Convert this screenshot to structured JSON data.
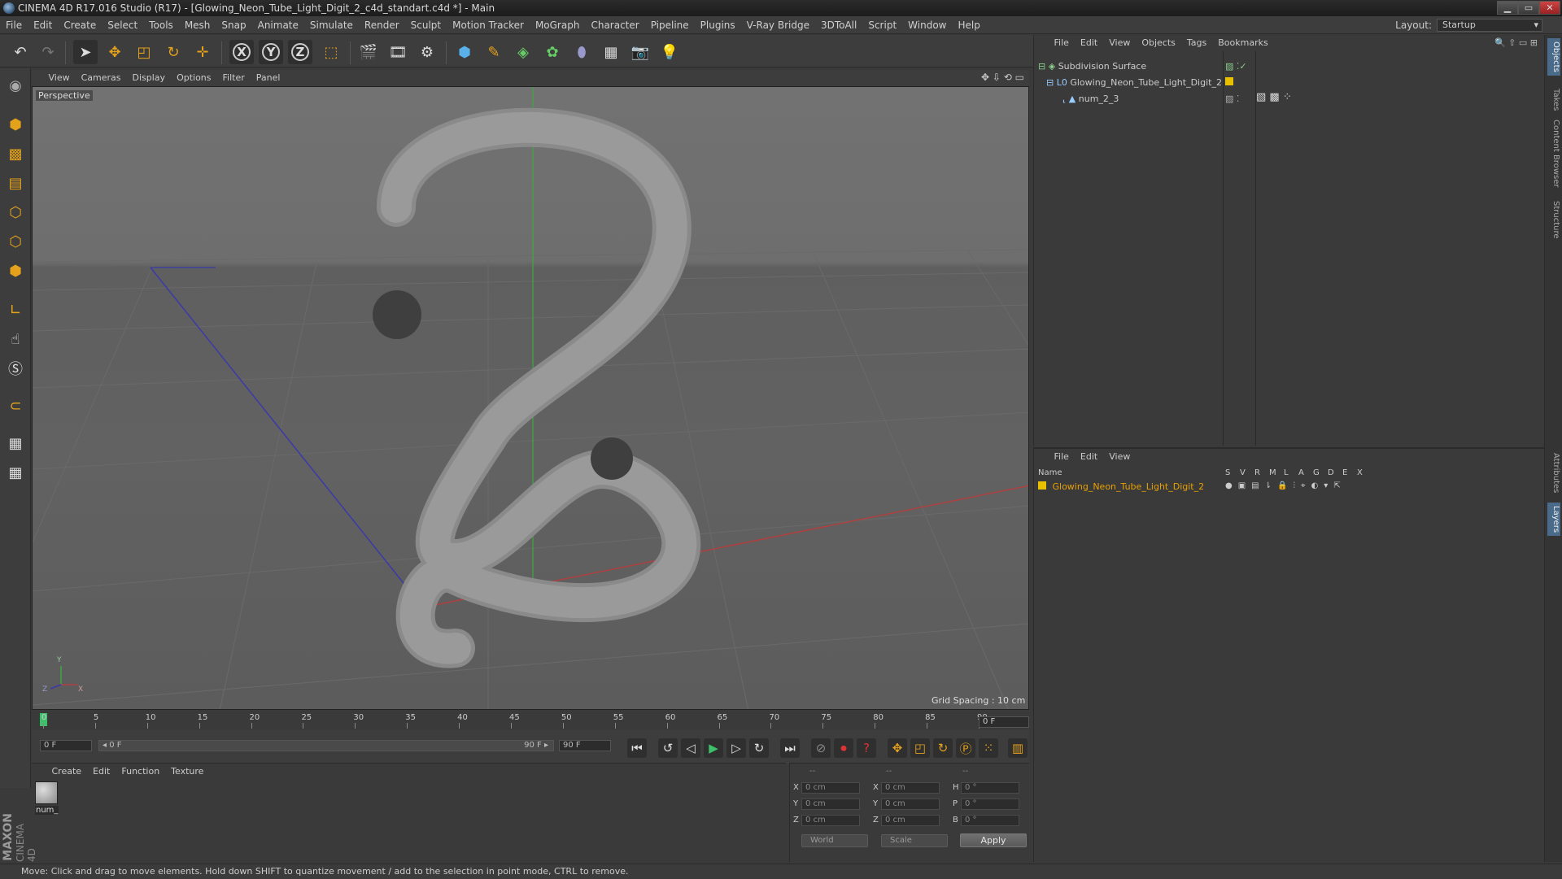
{
  "window": {
    "title": "CINEMA 4D R17.016 Studio (R17) - [Glowing_Neon_Tube_Light_Digit_2_c4d_standart.c4d *] - Main",
    "buttons": [
      "▁",
      "▭",
      "✕"
    ]
  },
  "menu": {
    "items": [
      "File",
      "Edit",
      "Create",
      "Select",
      "Tools",
      "Mesh",
      "Snap",
      "Animate",
      "Simulate",
      "Render",
      "Sculpt",
      "Motion Tracker",
      "MoGraph",
      "Character",
      "Pipeline",
      "Plugins",
      "V-Ray Bridge",
      "3DToAll",
      "Script",
      "Window",
      "Help"
    ],
    "layout_label": "Layout:",
    "layout_value": "Startup"
  },
  "toolbar": {
    "x_label": "X",
    "y_label": "Y",
    "z_label": "Z"
  },
  "viewport": {
    "menu": [
      "View",
      "Cameras",
      "Display",
      "Options",
      "Filter",
      "Panel"
    ],
    "label": "Perspective",
    "grid_spacing": "Grid Spacing : 10 cm",
    "axis_y": "Y",
    "axis_z": "Z",
    "axis_x": "X"
  },
  "timeline": {
    "ticks": [
      "0",
      "5",
      "10",
      "15",
      "20",
      "25",
      "30",
      "35",
      "40",
      "45",
      "50",
      "55",
      "60",
      "65",
      "70",
      "75",
      "80",
      "85",
      "90"
    ],
    "current_frame": "0 F"
  },
  "transport": {
    "start_field": "0 F",
    "range_start": "◂ 0 F",
    "range_end": "90 F ▸",
    "end_field": "90 F"
  },
  "materials": {
    "menu": [
      "Create",
      "Edit",
      "Function",
      "Texture"
    ],
    "items": [
      {
        "name": "num_"
      }
    ]
  },
  "coordinates": {
    "header": [
      "--",
      "--",
      "--"
    ],
    "rows": [
      {
        "axis": "X",
        "pos": "0 cm",
        "axis2": "X",
        "size": "0 cm",
        "rot_label": "H",
        "rot": "0 °"
      },
      {
        "axis": "Y",
        "pos": "0 cm",
        "axis2": "Y",
        "size": "0 cm",
        "rot_label": "P",
        "rot": "0 °"
      },
      {
        "axis": "Z",
        "pos": "0 cm",
        "axis2": "Z",
        "size": "0 cm",
        "rot_label": "B",
        "rot": "0 °"
      }
    ],
    "world": "World",
    "scale": "Scale",
    "apply": "Apply"
  },
  "status": {
    "text": "Move: Click and drag to move elements. Hold down SHIFT to quantize movement / add to the selection in point mode, CTRL to remove."
  },
  "objects": {
    "menu": [
      "File",
      "Edit",
      "View",
      "Objects",
      "Tags",
      "Bookmarks"
    ],
    "tree": [
      {
        "name": "Subdivision Surface",
        "indent": 0
      },
      {
        "name": "Glowing_Neon_Tube_Light_Digit_2",
        "indent": 1
      },
      {
        "name": "num_2_3",
        "indent": 2
      }
    ]
  },
  "layers": {
    "menu": [
      "File",
      "Edit",
      "View"
    ],
    "columns": [
      "Name",
      "S",
      "V",
      "R",
      "M",
      "L",
      "A",
      "G",
      "D",
      "E",
      "X"
    ],
    "rows": [
      {
        "name": "Glowing_Neon_Tube_Light_Digit_2",
        "color": "#e8c000"
      }
    ]
  },
  "right_tabs": [
    "Objects",
    "Takes",
    "Content Browser",
    "Structure",
    "Attributes",
    "Layers"
  ],
  "brand": {
    "maxon": "MAXON",
    "c4d": "CINEMA 4D"
  },
  "colors": {
    "accent": "#e4a11b",
    "layer_name": "#e8a000",
    "selected_tab": "#4a6a8a"
  }
}
